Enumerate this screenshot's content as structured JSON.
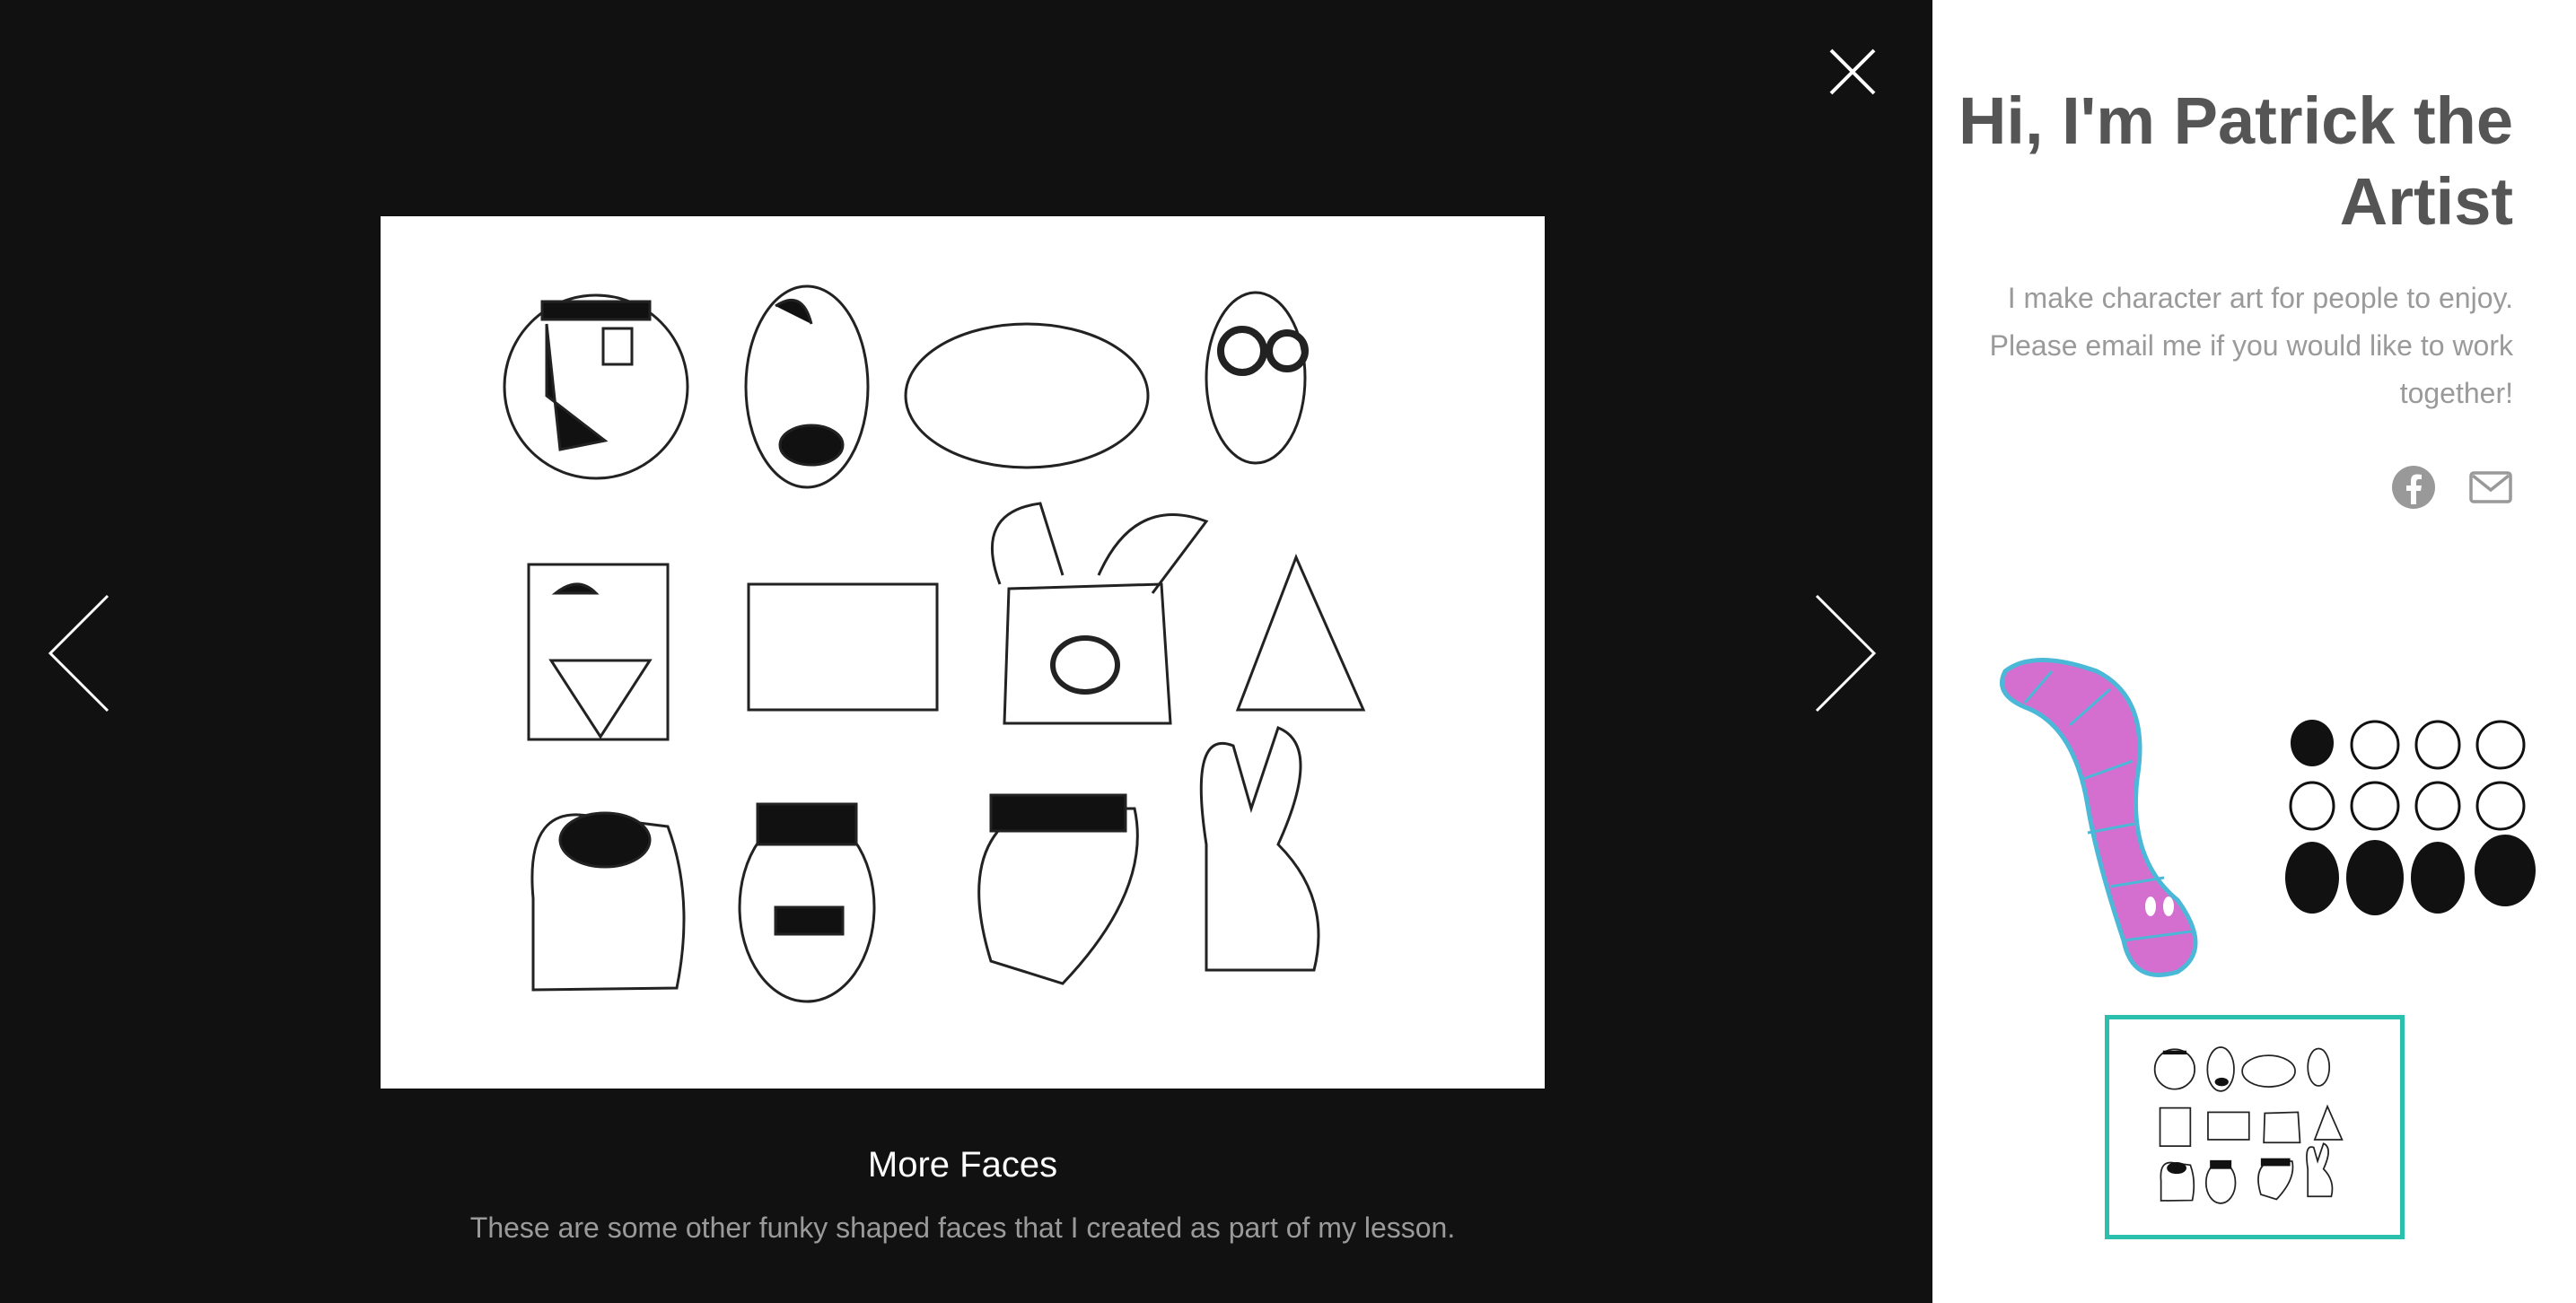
{
  "lightbox": {
    "caption_title": "More Faces",
    "caption_description": "These are some other funky shaped faces that I created as part of my lesson.",
    "close_icon": "close-icon",
    "prev_icon": "chevron-left-icon",
    "next_icon": "chevron-right-icon"
  },
  "profile": {
    "title": "Hi, I'm Patrick the Artist",
    "description": "I make character art for people to enjoy. Please email me if you would like to work together!",
    "social": [
      "facebook-icon",
      "mail-icon"
    ]
  },
  "thumbnails": [
    {
      "icon": "worm-drawing-thumbnail",
      "selected": false
    },
    {
      "icon": "faces-grid-thumbnail",
      "selected": false
    },
    {
      "icon": "more-faces-thumbnail",
      "selected": true
    }
  ],
  "colors": {
    "lightbox_bg": "#111111",
    "caption_text": "#ffffff",
    "caption_desc": "#9a9a9a",
    "title": "#555555",
    "selected_border": "#2bbfae",
    "worm_fill": "#d46fd0",
    "worm_stroke": "#4bb8d8"
  }
}
